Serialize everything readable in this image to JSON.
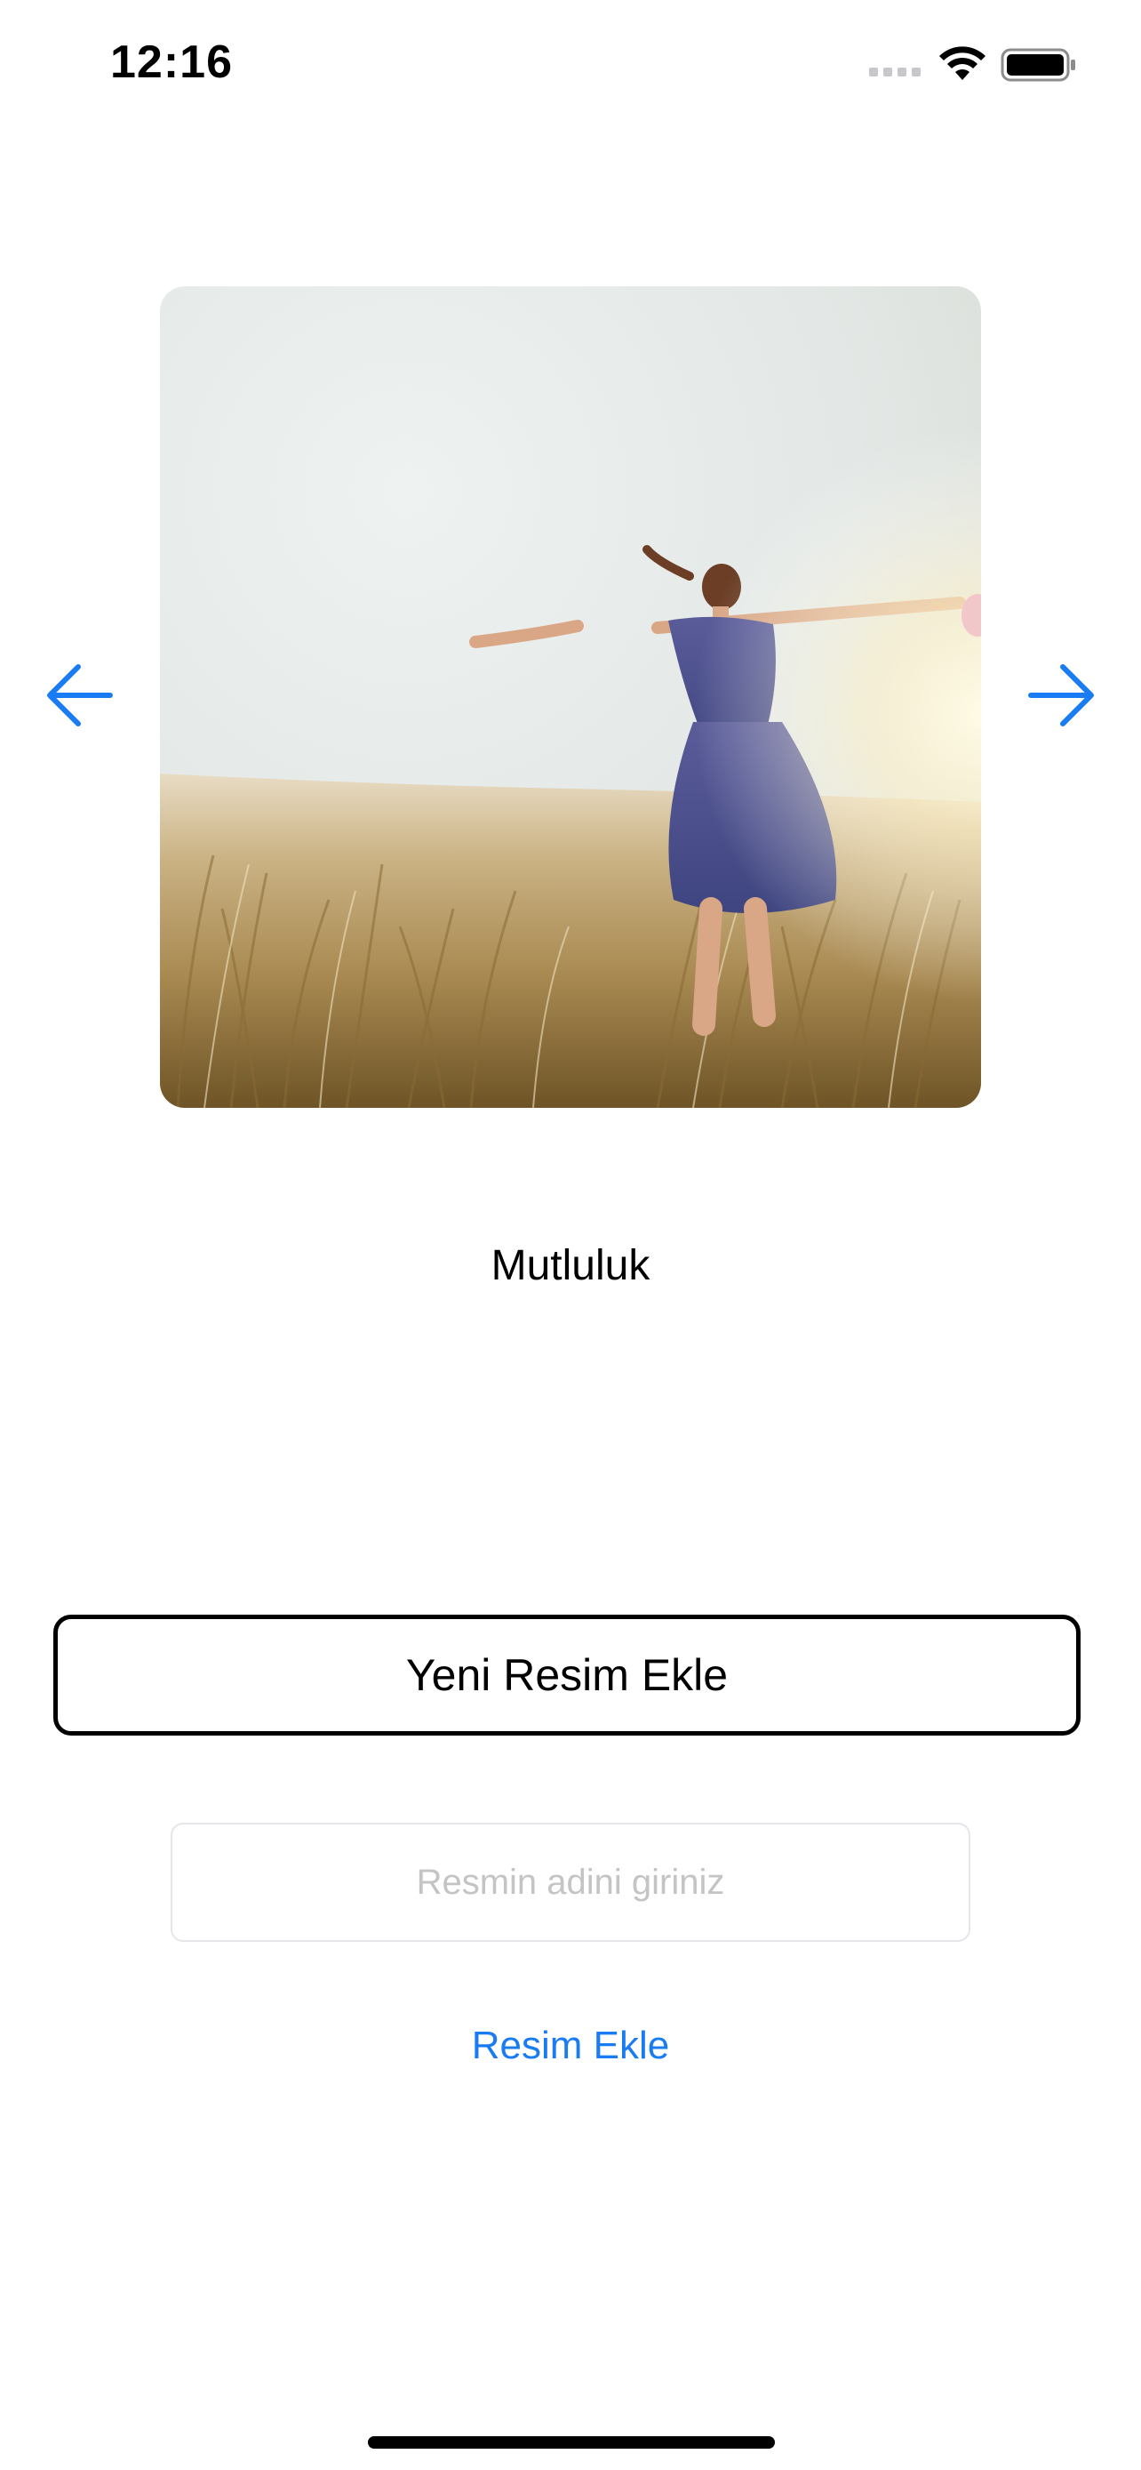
{
  "status_bar": {
    "time": "12:16",
    "icons": [
      "cellular-signal-icon",
      "wifi-icon",
      "battery-icon"
    ]
  },
  "navigation": {
    "previous_icon": "arrow-left-icon",
    "next_icon": "arrow-right-icon",
    "accent_color": "#1a7cf2"
  },
  "gallery": {
    "caption": "Mutluluk"
  },
  "actions": {
    "add_new_label": "Yeni Resim Ekle",
    "name_input_placeholder": "Resmin adini giriniz",
    "name_input_value": "",
    "add_link_label": "Resim Ekle"
  }
}
